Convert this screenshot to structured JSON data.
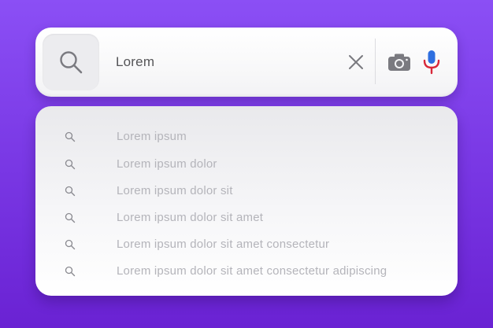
{
  "search": {
    "query": "Lorem",
    "icons": {
      "search": "magnifier-icon",
      "clear": "close-x-icon",
      "camera": "camera-icon",
      "mic": "microphone-icon"
    },
    "colors": {
      "mic_body": "#2f6fe0",
      "mic_stand": "#d8283a",
      "icon_gray": "#7a7a80"
    }
  },
  "suggestions": {
    "items": [
      {
        "label": "Lorem ipsum"
      },
      {
        "label": "Lorem ipsum dolor"
      },
      {
        "label": "Lorem ipsum dolor sit"
      },
      {
        "label": "Lorem ipsum dolor sit amet"
      },
      {
        "label": "Lorem ipsum dolor sit amet consectetur"
      },
      {
        "label": "Lorem ipsum dolor sit amet consectetur adipiscing"
      }
    ]
  },
  "background": {
    "gradient_top": "#8b4ff5",
    "gradient_bottom": "#6a22d3"
  }
}
